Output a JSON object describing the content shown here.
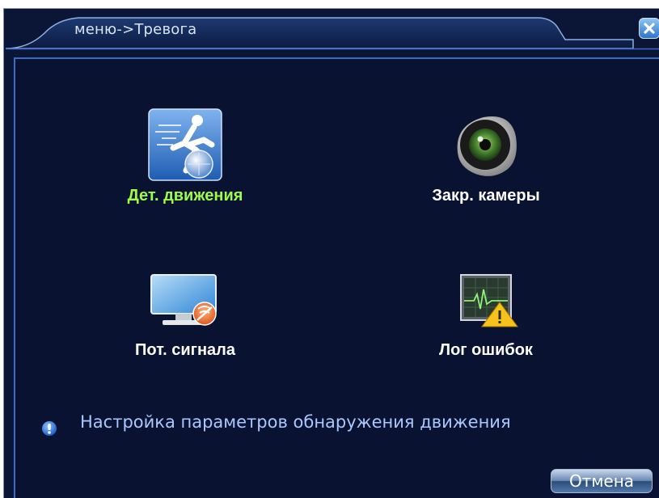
{
  "window": {
    "title": "меню->Тревога"
  },
  "tiles": [
    {
      "label": "Дет. движения",
      "icon": "motion-detect-icon",
      "selected": true
    },
    {
      "label": "Закр. камеры",
      "icon": "camera-eye-icon",
      "selected": false
    },
    {
      "label": "Пот. сигнала",
      "icon": "video-loss-icon",
      "selected": false
    },
    {
      "label": "Лог ошибок",
      "icon": "error-log-icon",
      "selected": false
    }
  ],
  "hint": {
    "text": "Настройка параметров обнаружения движения",
    "icon": "info-icon"
  },
  "buttons": {
    "cancel_label": "Отмена"
  },
  "colors": {
    "background": "#0b1535",
    "selected_label": "#9dfc4b",
    "hint_text": "#aac7ff",
    "border_accent": "#3a6bc6"
  }
}
